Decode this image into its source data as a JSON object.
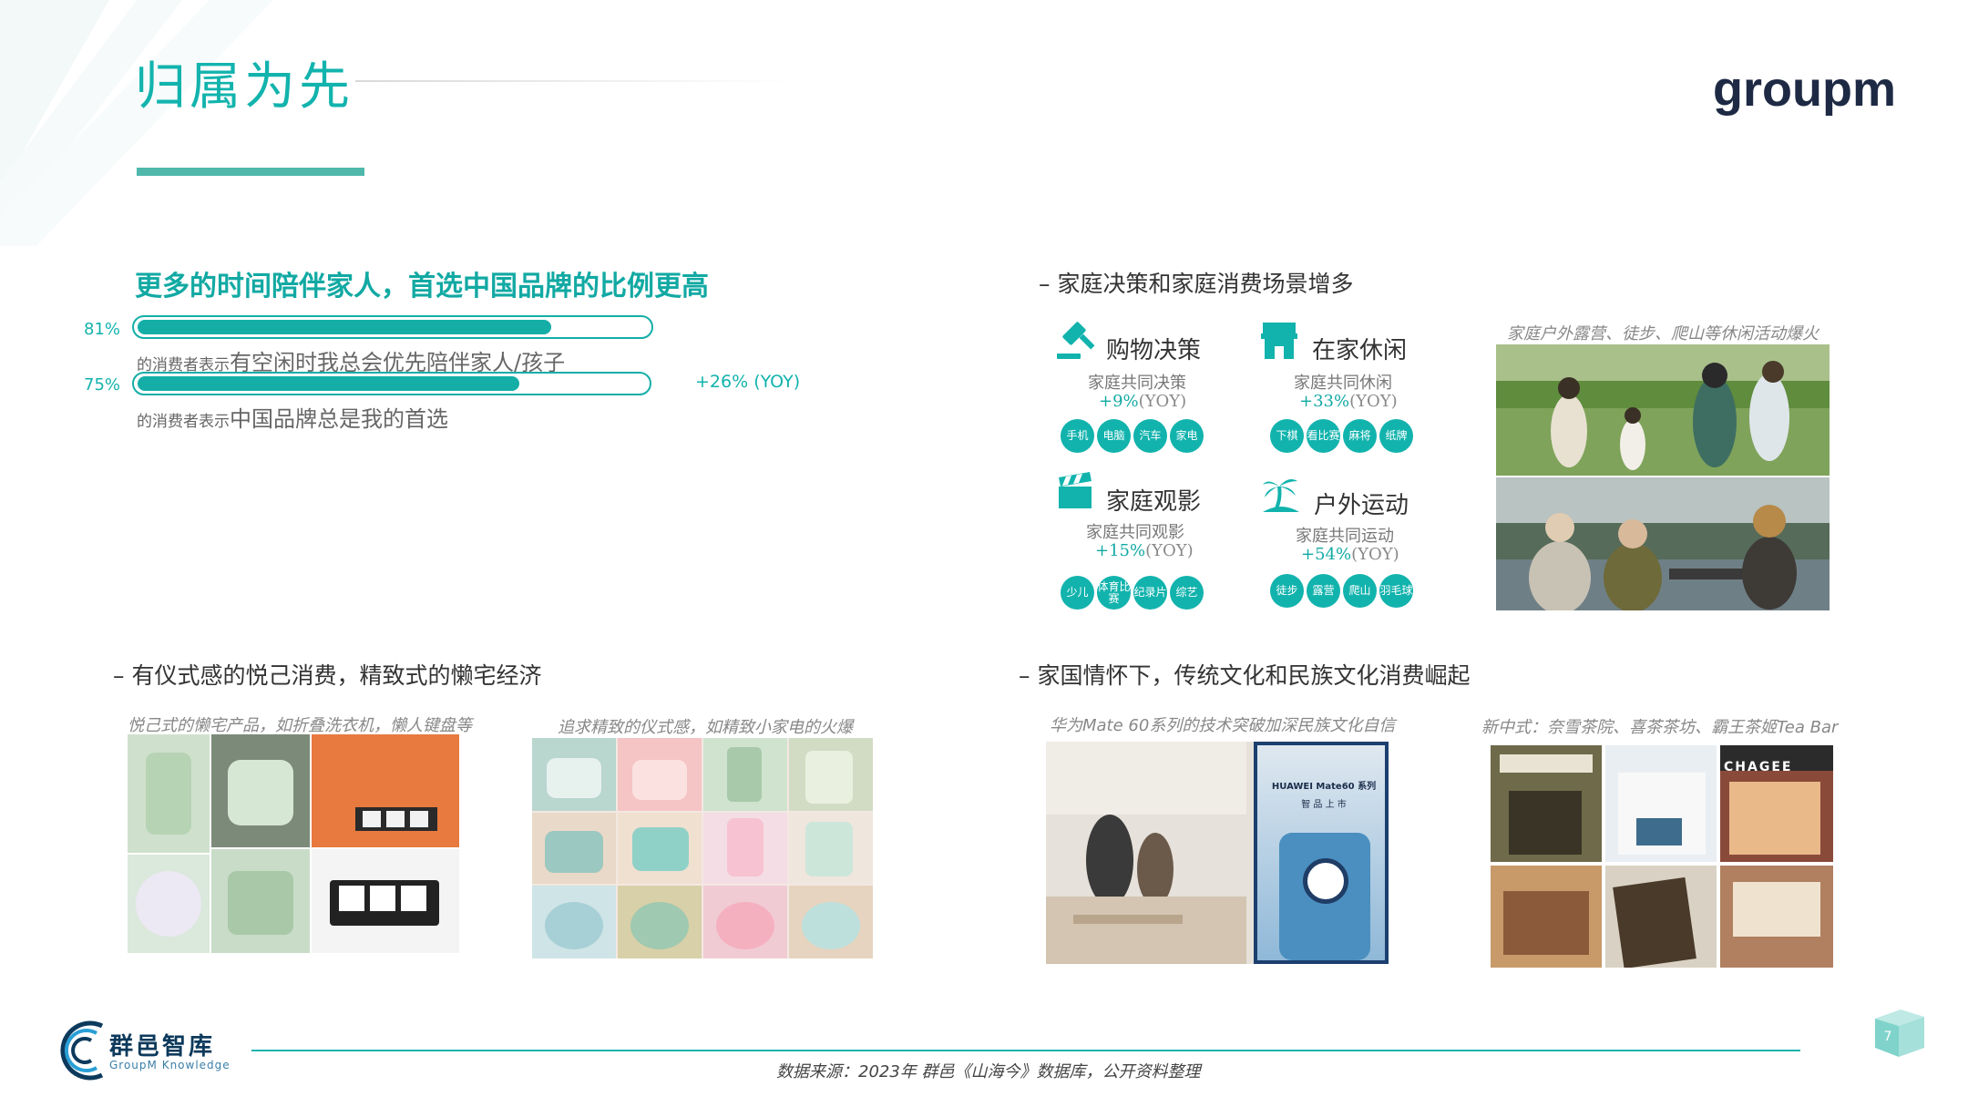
{
  "header": {
    "title": "归属为先",
    "logo_text": "groupm"
  },
  "section1": {
    "heading": "更多的时间陪伴家人，首选中国品牌的比例更高",
    "bars": [
      {
        "percent_label": "81%",
        "value": 81,
        "caption_small": "的消费者表示",
        "caption_large": "有空闲时我总会优先陪伴家人/孩子"
      },
      {
        "percent_label": "75%",
        "value": 75,
        "caption_small": "的消费者表示",
        "caption_large": "中国品牌总是我的首选"
      }
    ],
    "yoy": "+26% (YOY)"
  },
  "section2": {
    "heading": "– 家庭决策和家庭消费场景增多",
    "categories": [
      {
        "title": "购物决策",
        "icon": "gavel-icon",
        "sub": "家庭共同决策",
        "yoy_value": "+9%",
        "yoy_suffix": "(YOY)",
        "chips": [
          "手机",
          "电脑",
          "汽车",
          "家电"
        ]
      },
      {
        "title": "在家休闲",
        "icon": "home-icon",
        "sub": "家庭共同休闲",
        "yoy_value": "+33%",
        "yoy_suffix": "(YOY)",
        "chips": [
          "下棋",
          "看比赛",
          "麻将",
          "纸牌"
        ]
      },
      {
        "title": "家庭观影",
        "icon": "clapperboard-icon",
        "sub": "家庭共同观影",
        "yoy_value": "+15%",
        "yoy_suffix": "(YOY)",
        "chips": [
          "少儿",
          "体育比赛",
          "纪录片",
          "综艺"
        ]
      },
      {
        "title": "户外运动",
        "icon": "palm-tree-icon",
        "sub": "家庭共同运动",
        "yoy_value": "+54%",
        "yoy_suffix": "(YOY)",
        "chips": [
          "徒步",
          "露营",
          "爬山",
          "羽毛球"
        ]
      }
    ],
    "photo_caption": "家庭户外露营、徒步、爬山等休闲活动爆火"
  },
  "section3": {
    "heading": "– 有仪式感的悦己消费，精致式的懒宅经济",
    "caption_left": "悦己式的懒宅产品，如折叠洗衣机，懒人键盘等",
    "caption_right": "追求精致的仪式感，如精致小家电的火爆"
  },
  "section4": {
    "heading": "– 家国情怀下，传统文化和民族文化消费崛起",
    "caption_left": "华为Mate 60系列的技术突破加深民族文化自信",
    "caption_right": "新中式：奈雪茶院、喜茶茶坊、霸王茶姬Tea Bar",
    "phone_screen_line1": "HUAWEI Mate60 系列",
    "phone_screen_line2": "智 品 上 市",
    "store_sign": "CHAGEE"
  },
  "footer": {
    "source": "数据来源：2023年 群邑《山海今》数据库，公开资料整理",
    "brand_name": "群邑智库",
    "brand_sub": "GroupM Knowledge",
    "page_number": "7"
  },
  "colors": {
    "teal": "#12b3ad",
    "teal_dark": "#12a9a3",
    "navy": "#1e2a44"
  }
}
